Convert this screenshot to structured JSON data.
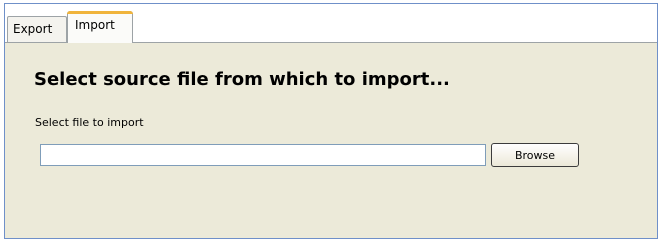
{
  "tabs": [
    {
      "label": "Export",
      "selected": false
    },
    {
      "label": "Import",
      "selected": true
    }
  ],
  "import_panel": {
    "heading": "Select source file from which to import...",
    "field_label": "Select file to import",
    "file_input": {
      "value": "",
      "placeholder": ""
    },
    "browse_label": "Browse"
  },
  "colors": {
    "panel_background": "#ecead9",
    "selected_tab_accent": "#f0b43c",
    "frame_border": "#6f90c9"
  }
}
